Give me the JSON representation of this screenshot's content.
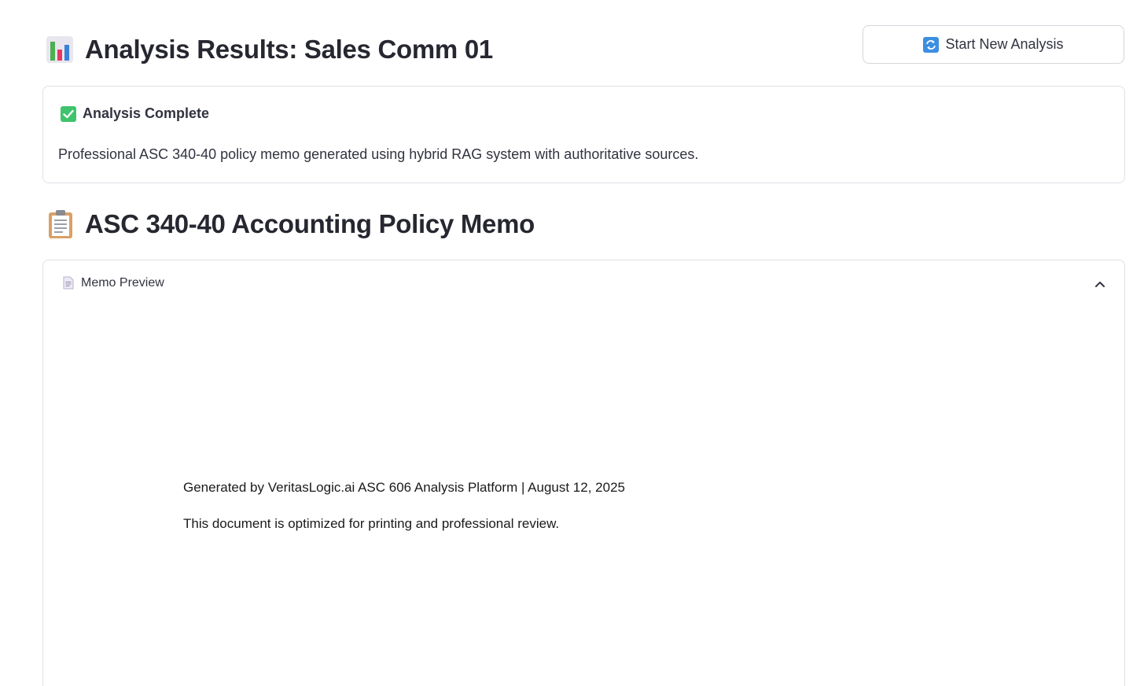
{
  "header": {
    "title": "Analysis Results: Sales Comm 01",
    "title_icon": "bar-chart-icon"
  },
  "actions": {
    "new_analysis_label": "Start New Analysis",
    "new_analysis_icon": "refresh-icon"
  },
  "status": {
    "title": "Analysis Complete",
    "icon": "check-mark-icon",
    "description": "Professional ASC 340-40 policy memo generated using hybrid RAG system with authoritative sources."
  },
  "memo": {
    "title": "ASC 340-40 Accounting Policy Memo",
    "title_icon": "clipboard-icon",
    "expander": {
      "label": "Memo Preview",
      "icon": "document-icon",
      "expanded": true
    },
    "footer": {
      "generated_by": "Generated by VeritasLogic.ai ASC 606 Analysis Platform | August 12, 2025",
      "note": "This document is optimized for printing and professional review."
    }
  },
  "colors": {
    "check_green": "#3ec46d",
    "refresh_blue": "#3b8fe0",
    "border": "#dfe1e6",
    "text": "#31333f"
  }
}
